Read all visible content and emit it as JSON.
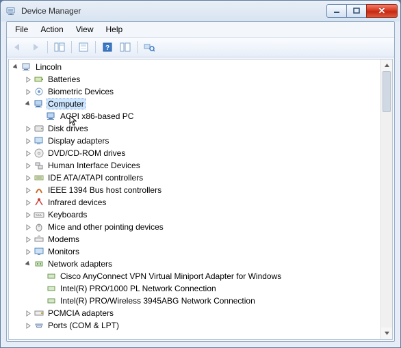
{
  "window": {
    "title": "Device Manager"
  },
  "menu": {
    "file": "File",
    "action": "Action",
    "view": "View",
    "help": "Help"
  },
  "toolbar": {
    "back": "back",
    "forward": "forward",
    "show_hide": "show-hide-console-tree",
    "properties": "properties",
    "help": "help",
    "show_hidden": "show-hidden-devices",
    "scan": "scan-for-hardware-changes"
  },
  "tree": {
    "root": "Lincoln",
    "batteries": "Batteries",
    "biometric": "Biometric Devices",
    "computer": "Computer",
    "computer_child": "ACPI x86-based PC",
    "disk": "Disk drives",
    "display": "Display adapters",
    "dvd": "DVD/CD-ROM drives",
    "hid": "Human Interface Devices",
    "ide": "IDE ATA/ATAPI controllers",
    "ieee1394": "IEEE 1394 Bus host controllers",
    "infrared": "Infrared devices",
    "keyboards": "Keyboards",
    "mice": "Mice and other pointing devices",
    "modems": "Modems",
    "monitors": "Monitors",
    "network": "Network adapters",
    "net1": "Cisco AnyConnect VPN Virtual Miniport Adapter for Windows",
    "net2": "Intel(R) PRO/1000 PL Network Connection",
    "net3": "Intel(R) PRO/Wireless 3945ABG Network Connection",
    "pcmcia": "PCMCIA adapters",
    "ports": "Ports (COM & LPT)"
  }
}
